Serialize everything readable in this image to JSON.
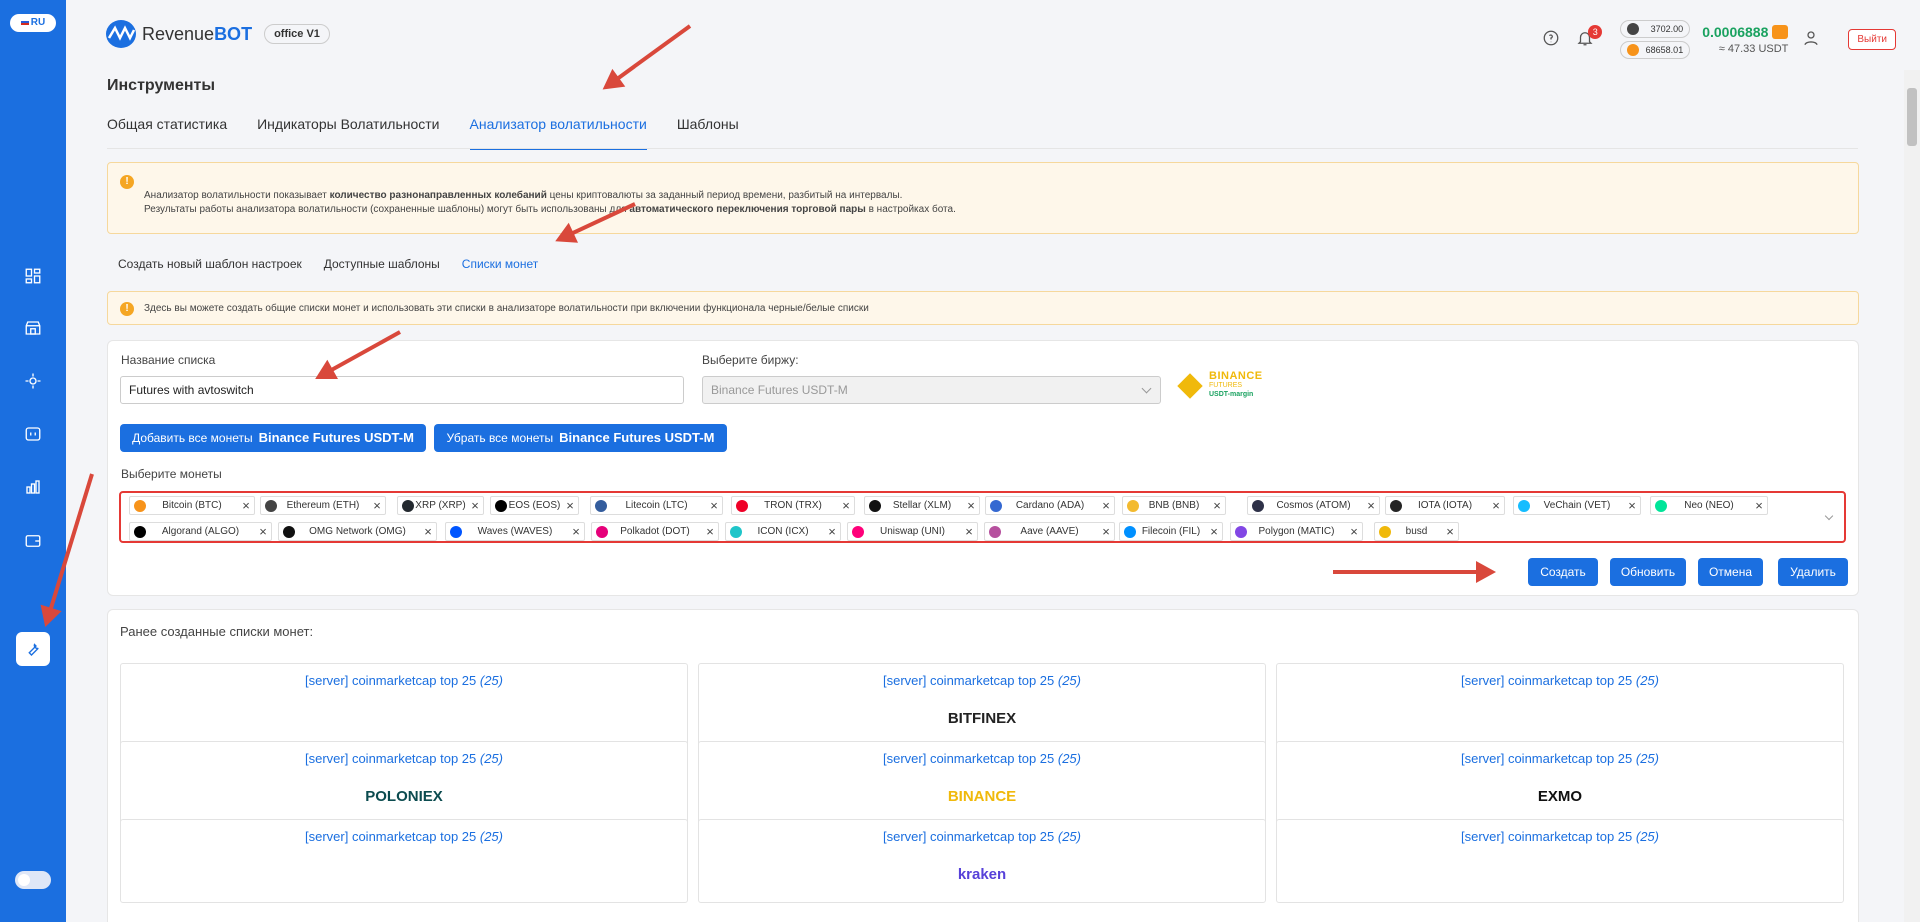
{
  "lang": "RU",
  "app": {
    "logo_text_a": "Revenue",
    "logo_text_b": "BOT",
    "office": "office V1"
  },
  "header": {
    "notif_count": "3",
    "eth_price": "3702.00",
    "btc_price": "68658.01",
    "balance": "0.0006888",
    "balance_usdt": "≈ 47.33 USDT",
    "logout": "Выйти"
  },
  "page_title": "Инструменты",
  "tabs": [
    {
      "label": "Общая статистика"
    },
    {
      "label": "Индикаторы Волатильности"
    },
    {
      "label": "Анализатор волатильности"
    },
    {
      "label": "Шаблоны"
    }
  ],
  "info1": {
    "l1a": "Анализатор волатильности показывает ",
    "l1b": "количество разнонаправленных колебаний",
    "l1c": " цены криптовалюты за заданный период времени, разбитый на интервалы.",
    "l2a": "Результаты работы анализатора волатильности (сохраненные шаблоны) могут быть использованы для ",
    "l2b": "автоматического переключения торговой пары",
    "l2c": " в настройках бота."
  },
  "subtabs": [
    {
      "label": "Создать новый шаблон настроек"
    },
    {
      "label": "Доступные шаблоны"
    },
    {
      "label": "Списки монет"
    }
  ],
  "info2": "Здесь вы можете создать общие списки монет и использовать эти списки в анализаторе волатильности при включении функционала черные/белые списки",
  "form": {
    "list_name_label": "Название списка",
    "list_name_value": "Futures with avtoswitch",
    "exchange_label": "Выберите биржу:",
    "exchange_value": "Binance Futures USDT-M",
    "exchange_logo_a": "BINANCE",
    "exchange_logo_b": "FUTURES",
    "exchange_logo_c": "USDT-margin",
    "add_all": "Добавить все монеты",
    "remove_all": "Убрать все монеты",
    "exchange_bold": "Binance Futures USDT-M",
    "coins_label": "Выберите монеты",
    "coins": [
      {
        "name": "Bitcoin (BTC)",
        "color": "#f7931a"
      },
      {
        "name": "Ethereum (ETH)",
        "color": "#444444"
      },
      {
        "name": "XRP (XRP)",
        "color": "#23292f"
      },
      {
        "name": "EOS (EOS)",
        "color": "#000000"
      },
      {
        "name": "Litecoin (LTC)",
        "color": "#345d9d"
      },
      {
        "name": "TRON (TRX)",
        "color": "#ef0027"
      },
      {
        "name": "Stellar (XLM)",
        "color": "#111111"
      },
      {
        "name": "Cardano (ADA)",
        "color": "#3468d1"
      },
      {
        "name": "BNB (BNB)",
        "color": "#f3ba2f"
      },
      {
        "name": "Cosmos (ATOM)",
        "color": "#2e3148"
      },
      {
        "name": "IOTA (IOTA)",
        "color": "#242424"
      },
      {
        "name": "VeChain (VET)",
        "color": "#15bdff"
      },
      {
        "name": "Neo (NEO)",
        "color": "#00e599"
      },
      {
        "name": "Algorand (ALGO)",
        "color": "#000000"
      },
      {
        "name": "OMG Network (OMG)",
        "color": "#101010"
      },
      {
        "name": "Waves (WAVES)",
        "color": "#0055ff"
      },
      {
        "name": "Polkadot (DOT)",
        "color": "#e6007a"
      },
      {
        "name": "ICON (ICX)",
        "color": "#1fc5c9"
      },
      {
        "name": "Uniswap (UNI)",
        "color": "#ff007a"
      },
      {
        "name": "Aave (AAVE)",
        "color": "#b6509e"
      },
      {
        "name": "Filecoin (FIL)",
        "color": "#0090ff"
      },
      {
        "name": "Polygon (MATIC)",
        "color": "#8247e5"
      },
      {
        "name": "busd",
        "color": "#f0b90b"
      }
    ],
    "btn_create": "Создать",
    "btn_update": "Обновить",
    "btn_cancel": "Отмена",
    "btn_delete": "Удалить"
  },
  "previous": {
    "title": "Ранее созданные списки монет:",
    "lists": [
      {
        "name": "[server] coinmarketcap top 25 ",
        "count": "(25)",
        "exchange": "",
        "ex_color": "#000000"
      },
      {
        "name": "[server] coinmarketcap top 25 ",
        "count": "(25)",
        "exchange": "BITFINEX",
        "ex_color": "#222222"
      },
      {
        "name": "[server] coinmarketcap top 25 ",
        "count": "(25)",
        "exchange": "",
        "ex_color": "#000000"
      },
      {
        "name": "[server] coinmarketcap top 25 ",
        "count": "(25)",
        "exchange": "POLONIEX",
        "ex_color": "#0b4b4f"
      },
      {
        "name": "[server] coinmarketcap top 25 ",
        "count": "(25)",
        "exchange": "BINANCE",
        "ex_color": "#f0b90b"
      },
      {
        "name": "[server] coinmarketcap top 25 ",
        "count": "(25)",
        "exchange": "EXMO",
        "ex_color": "#111111"
      },
      {
        "name": "[server] coinmarketcap top 25 ",
        "count": "(25)",
        "exchange": "",
        "ex_color": "#1c9ad6"
      },
      {
        "name": "[server] coinmarketcap top 25 ",
        "count": "(25)",
        "exchange": "kraken",
        "ex_color": "#5741d9"
      },
      {
        "name": "[server] coinmarketcap top 25 ",
        "count": "(25)",
        "exchange": "",
        "ex_color": "#000000"
      }
    ]
  }
}
